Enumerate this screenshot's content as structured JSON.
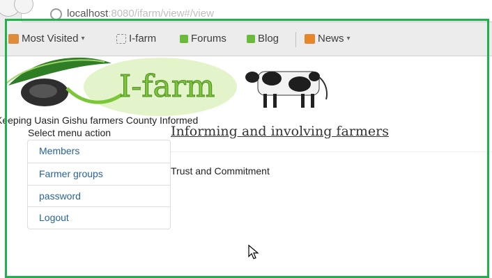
{
  "browser": {
    "url_host": "localhost",
    "url_rest": ":8080/ifarm/view#/view"
  },
  "bookmarks": {
    "most_visited": "Most Visited",
    "ifarm": "I-farm",
    "forums": "Forums",
    "blog": "Blog",
    "news": "News"
  },
  "site": {
    "logo_text": "I-farm",
    "tagline": "Keeping Uasin Gishu farmers County Informed",
    "menu_caption": "Select menu action",
    "hero": "Informing and involving farmers",
    "trust": "Trust and Commitment"
  },
  "menu": {
    "items": [
      "Members",
      "Farmer groups",
      "password",
      "Logout"
    ]
  },
  "colors": {
    "highlight_frame": "#1db24a",
    "link": "#2a6496",
    "logo_green": "#7cc63a"
  },
  "icons": {
    "dropdown": "chevron-down-icon",
    "rss": "rss-icon",
    "bookmark": "bookmark-icon"
  }
}
